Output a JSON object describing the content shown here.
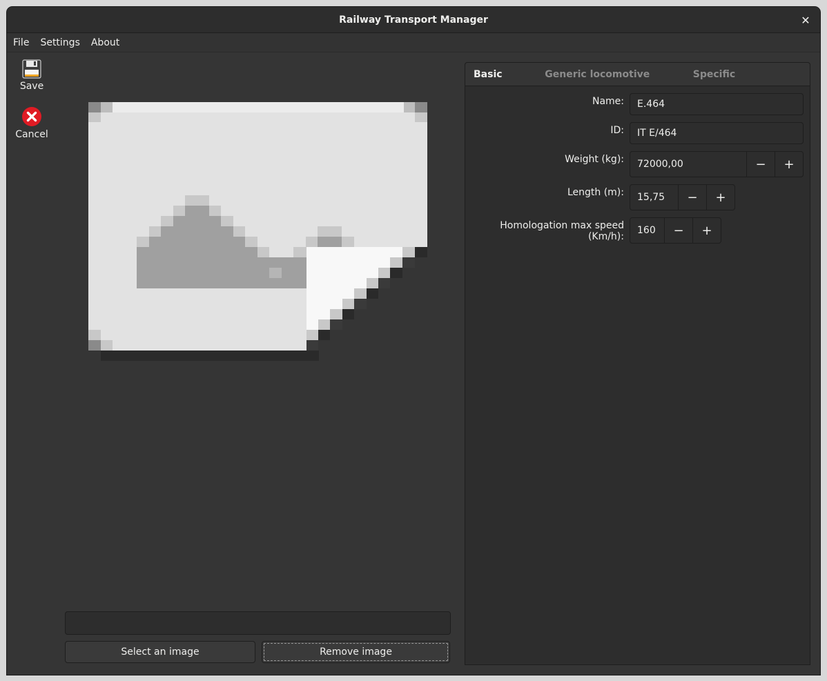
{
  "window": {
    "title": "Railway Transport Manager"
  },
  "menubar": {
    "items": [
      "File",
      "Settings",
      "About"
    ]
  },
  "toolbar": {
    "save_label": "Save",
    "cancel_label": "Cancel"
  },
  "image_panel": {
    "path_value": "",
    "select_label": "Select an image",
    "remove_label": "Remove image"
  },
  "tabs": [
    "Basic info",
    "Generic locomotive info",
    "Specific information"
  ],
  "basic_info": {
    "name_label": "Name:",
    "name_value": "E.464",
    "id_label": "ID:",
    "id_value": "IT E/464",
    "weight_label": "Weight (kg):",
    "weight_value": "72000,00",
    "length_label": "Length (m):",
    "length_value": "15,75",
    "speed_label": "Homologation max speed (Km/h):",
    "speed_value": "160"
  },
  "spin_buttons": {
    "minus": "−",
    "plus": "+"
  },
  "close_glyph": "✕",
  "colors": {
    "accent": "#3584e4",
    "cancel_icon": "#e01b24",
    "save_icon_accent": "#f5a623"
  }
}
